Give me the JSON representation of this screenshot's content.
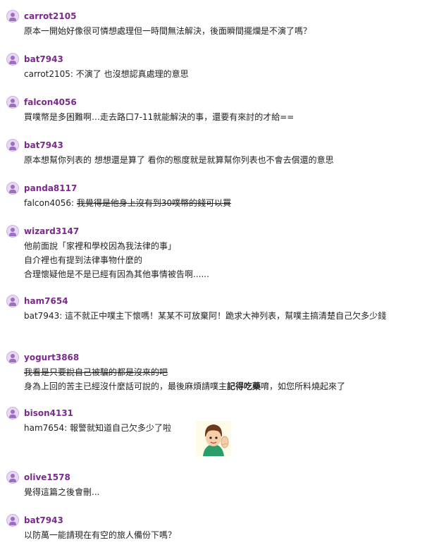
{
  "comments": [
    {
      "user": "carrot2105",
      "lines": [
        {
          "t": "原本一開始好像很可憐想處理但一時間無法解決，後面瞬間擺爛是不演了嗎？"
        }
      ]
    },
    {
      "user": "bat7943",
      "lines": [
        {
          "t": "carrot2105: 不演了 也沒想認真處理的意思"
        }
      ]
    },
    {
      "user": "falcon4056",
      "lines": [
        {
          "t": "買噗幣是多困難啊…走去路口7-11就能解決的事，還要有來討的才給=="
        }
      ]
    },
    {
      "user": "bat7943",
      "lines": [
        {
          "t": "原本想幫你列表的 想想還是算了 看你的態度就是就算幫你列表也不會去償還的意思"
        }
      ]
    },
    {
      "user": "panda8117",
      "prefix": "falcon4056: ",
      "strike": "我覺得是他身上沒有到30噗幣的錢可以買"
    },
    {
      "user": "wizard3147",
      "lines": [
        {
          "t": "他前面說「家裡和學校因為我法律的事」"
        },
        {
          "t": "自介裡也有提到法律事物什麼的"
        },
        {
          "t": "合理懷疑他是不是已經有因為其他事情被告啊......"
        }
      ]
    },
    {
      "user": "ham7654",
      "wrap": "bat7943: 這不就正中噗主下懷嗎！某某不可放棄阿！跪求大神列表，幫噗主搞清楚自己欠多少錢"
    },
    {
      "user": "yogurt3868",
      "strike_line": "我看是只要說自己被騙的都是沒來的吧",
      "mixed": {
        "a": "身為上回的苦主已經沒什麼話可說的，最後麻煩請噗主",
        "b": "記得吃藥",
        "c": "唷，如您所料燒起來了"
      }
    },
    {
      "user": "bison4131",
      "lines": [
        {
          "t": "ham7654: 報警就知道自己欠多少了啦"
        }
      ],
      "sticker_icon": "waving-sticker-icon"
    },
    {
      "user": "olive1578",
      "lines": [
        {
          "t": "覺得這篇之後會刪..."
        }
      ]
    },
    {
      "user": "bat7943",
      "lines": [
        {
          "t": "以防萬一能請現在有空的旅人備份下嗎？"
        }
      ]
    }
  ]
}
